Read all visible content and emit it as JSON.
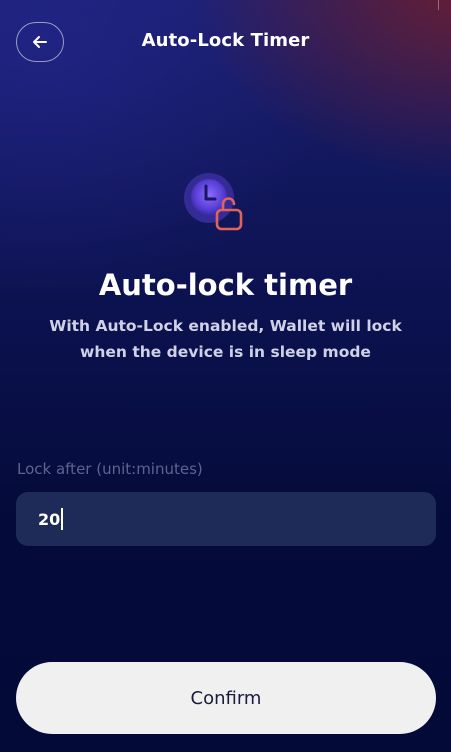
{
  "header": {
    "back_icon": "arrow-left-icon",
    "title": "Auto-Lock Timer"
  },
  "hero": {
    "icon": "clock-unlock-icon",
    "title": "Auto-lock timer",
    "description": "With Auto-Lock enabled, Wallet will lock when the device is in sleep mode"
  },
  "form": {
    "label": "Lock after (unit:minutes)",
    "value": "20"
  },
  "actions": {
    "confirm_label": "Confirm"
  },
  "colors": {
    "background_top": "#1a1f6e",
    "background_bottom": "#030a38",
    "accent_red": "#e0645a",
    "clock_purple": "#6a4fe6",
    "input_bg": "#1e2a57",
    "button_bg": "#f0f0f0"
  }
}
